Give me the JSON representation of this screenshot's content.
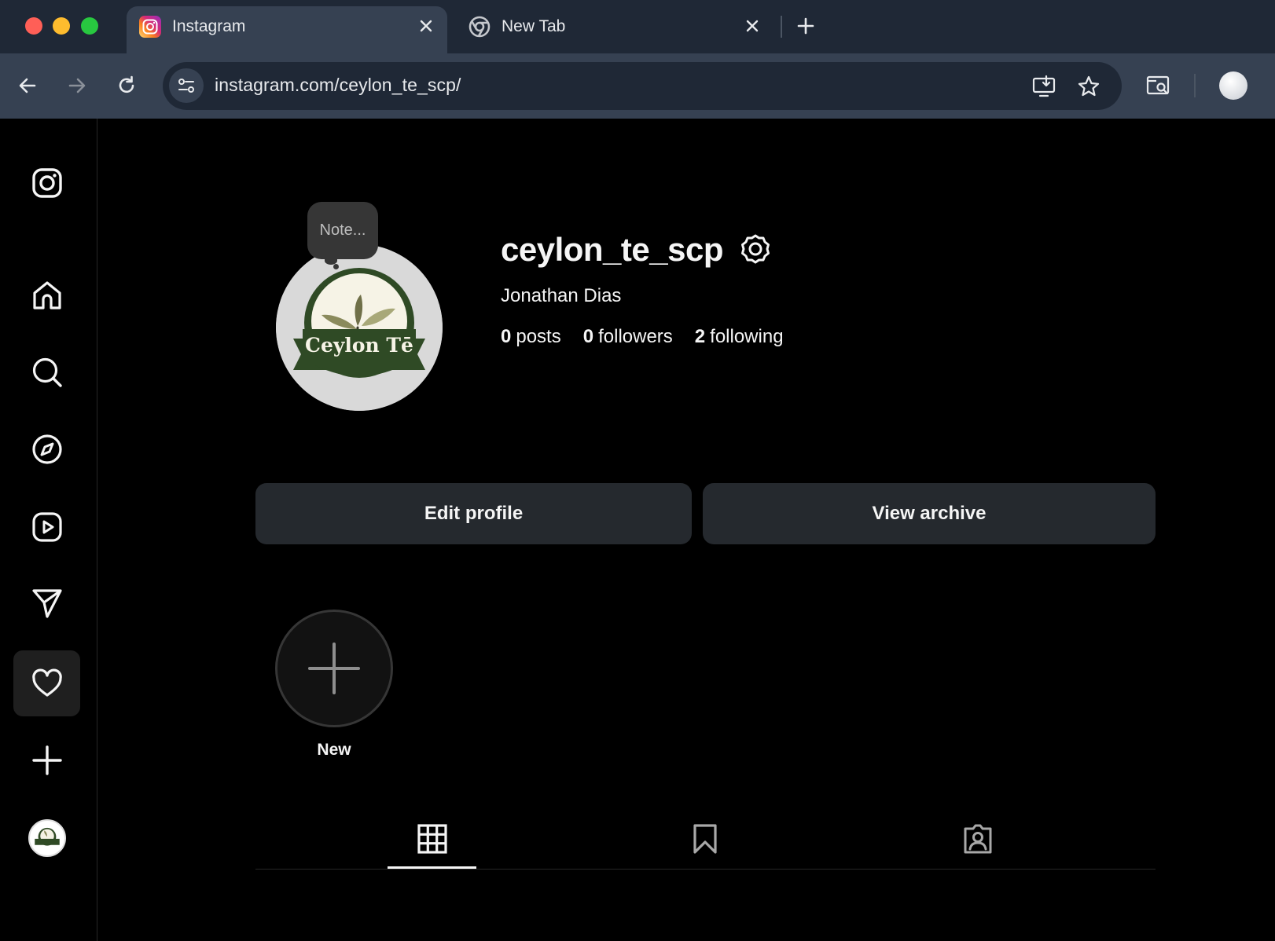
{
  "browser": {
    "tabs": [
      {
        "title": "Instagram",
        "active": true
      },
      {
        "title": "New Tab",
        "active": false
      }
    ],
    "url": "instagram.com/ceylon_te_scp/"
  },
  "sidebar": {
    "items": [
      {
        "name": "instagram-logo-icon"
      },
      {
        "name": "home-icon"
      },
      {
        "name": "search-icon"
      },
      {
        "name": "explore-compass-icon"
      },
      {
        "name": "reels-icon"
      },
      {
        "name": "messages-paper-plane-icon"
      },
      {
        "name": "notifications-heart-icon",
        "active": true
      },
      {
        "name": "create-plus-icon"
      },
      {
        "name": "profile-avatar"
      }
    ]
  },
  "profile": {
    "note": "Note...",
    "username": "ceylon_te_scp",
    "full_name": "Jonathan Dias",
    "stats": {
      "posts_count": "0",
      "posts_label": "posts",
      "followers_count": "0",
      "followers_label": "followers",
      "following_count": "2",
      "following_label": "following"
    },
    "avatar_text": "Ceylon Tē",
    "edit_profile_label": "Edit profile",
    "view_archive_label": "View archive",
    "highlight_new_label": "New",
    "tabs": [
      "posts-grid",
      "saved",
      "tagged"
    ],
    "active_tab": "posts-grid"
  },
  "colors": {
    "background": "#000000",
    "button_bg": "#25292e",
    "brand_green": "#2f4a25",
    "browser_dark": "#1f2836",
    "browser_light": "#364152"
  }
}
